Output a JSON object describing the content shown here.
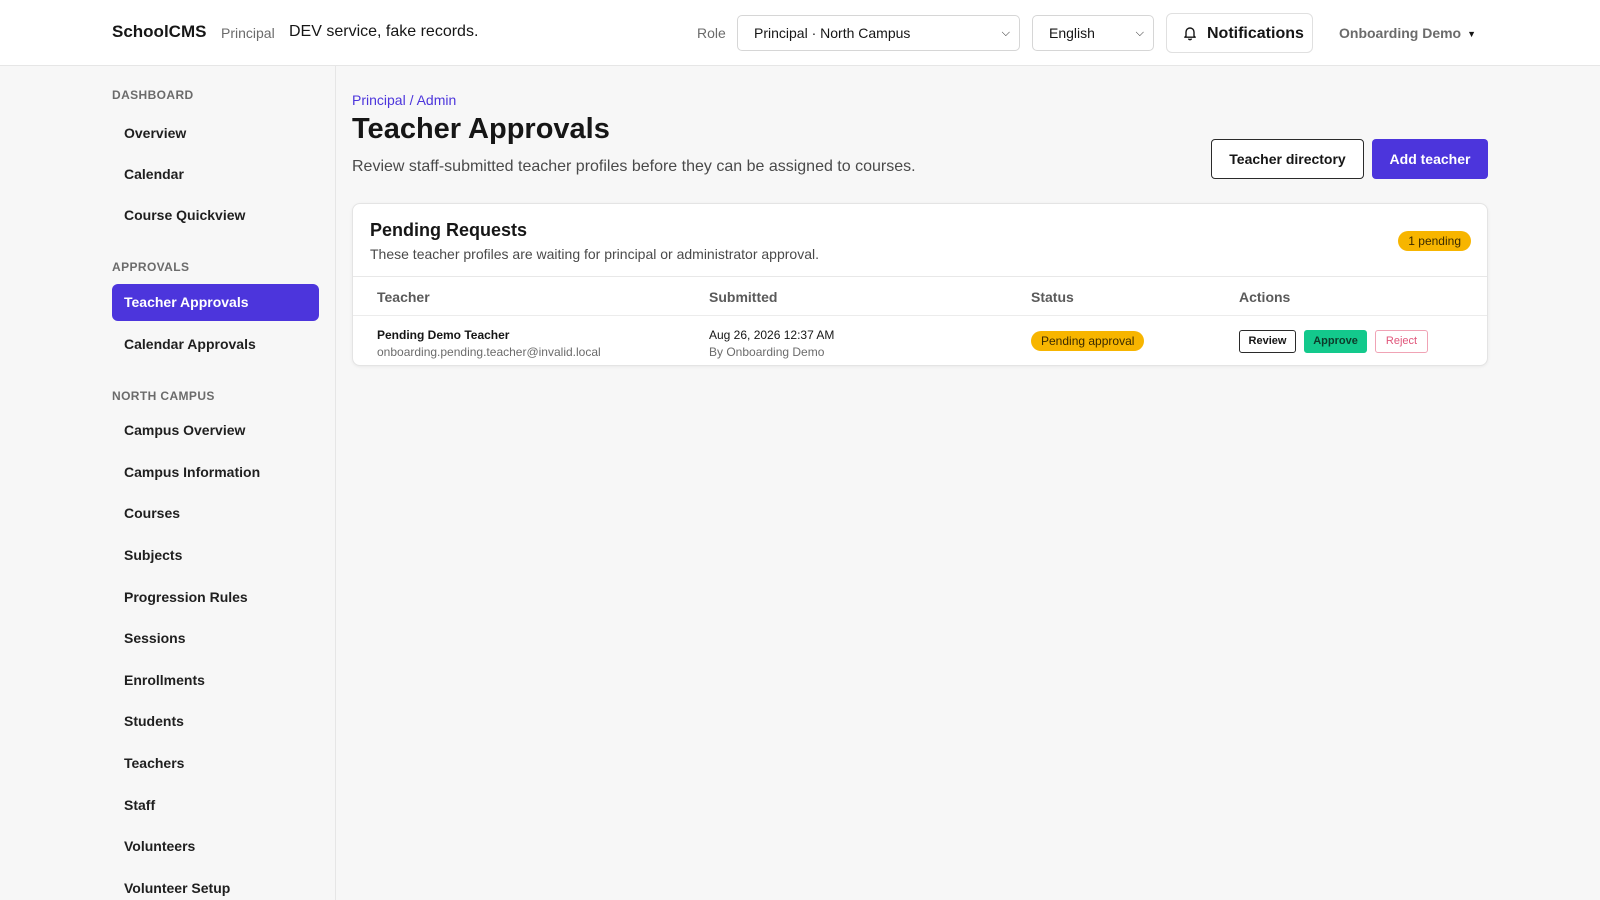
{
  "header": {
    "brand": "SchoolCMS",
    "brand_role": "Principal",
    "env_note": "DEV service, fake records.",
    "role_label": "Role",
    "role_value": "Principal · North Campus",
    "language_value": "English",
    "notifications_label": "Notifications",
    "user_name": "Onboarding Demo"
  },
  "sidebar": {
    "sections": [
      {
        "title": "Dashboard",
        "items": [
          "Overview",
          "Calendar",
          "Course Quickview"
        ]
      },
      {
        "title": "Approvals",
        "items": [
          "Teacher Approvals",
          "Calendar Approvals"
        ]
      },
      {
        "title": "North Campus",
        "items": [
          "Campus Overview",
          "Campus Information",
          "Courses",
          "Subjects",
          "Progression Rules",
          "Sessions",
          "Enrollments",
          "Students",
          "Teachers",
          "Staff",
          "Volunteers",
          "Volunteer Setup"
        ]
      }
    ],
    "active_item": "Teacher Approvals"
  },
  "main": {
    "breadcrumb": "Principal / Admin",
    "title": "Teacher Approvals",
    "subtitle": "Review staff-submitted teacher profiles before they can be assigned to courses.",
    "directory_button": "Teacher directory",
    "add_button": "Add teacher",
    "card": {
      "title": "Pending Requests",
      "subtitle": "These teacher profiles are waiting for principal or administrator approval.",
      "badge": "1 pending",
      "columns": [
        "Teacher",
        "Submitted",
        "Status",
        "Actions"
      ],
      "rows": [
        {
          "name": "Pending Demo Teacher",
          "email": "onboarding.pending.teacher@invalid.local",
          "submitted": "Aug 26, 2026 12:37 AM",
          "submitted_by": "By Onboarding Demo",
          "status": "Pending approval",
          "review": "Review",
          "approve": "Approve",
          "reject": "Reject"
        }
      ]
    }
  },
  "colors": {
    "accent": "#4c35dc",
    "warning": "#f7b500",
    "success": "#13c98c",
    "danger": "#e0557a"
  }
}
